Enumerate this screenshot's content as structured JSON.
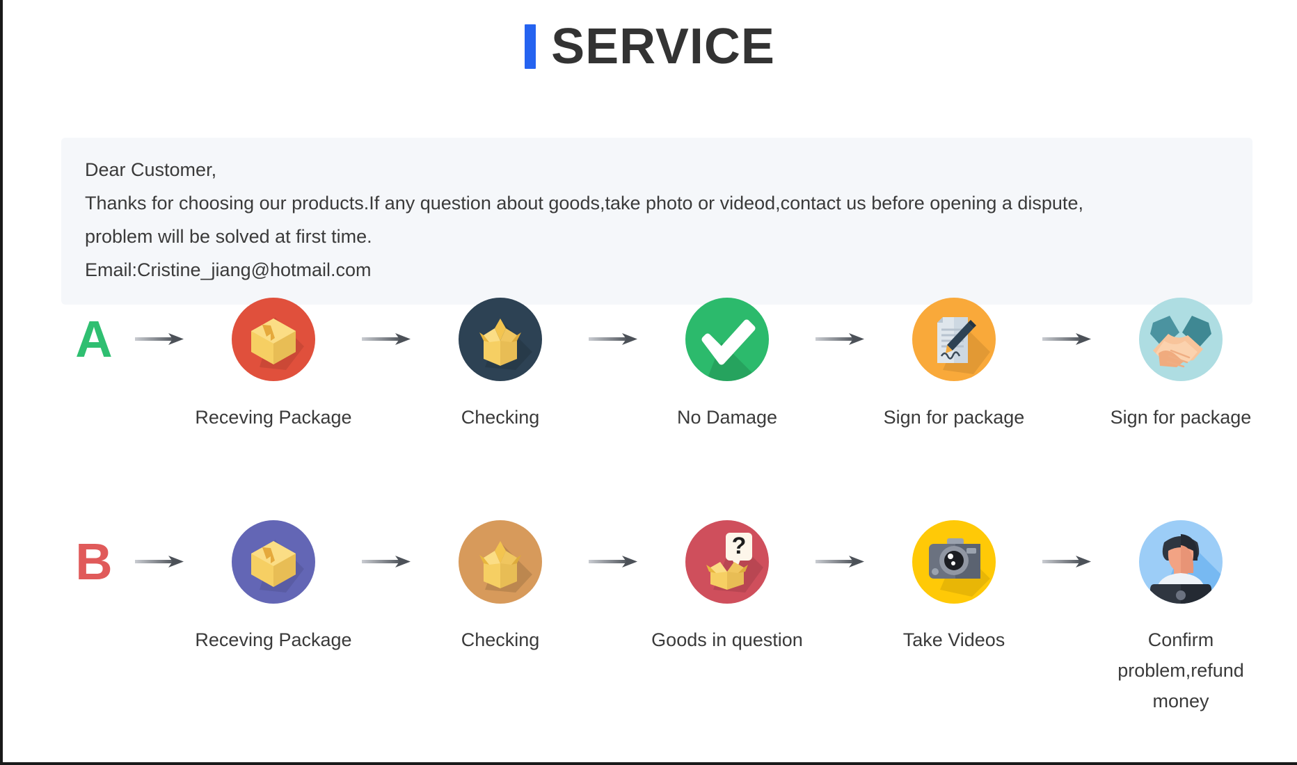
{
  "header": {
    "title": "SERVICE",
    "accent_color": "#2563f0"
  },
  "notice": {
    "line1": "Dear Customer,",
    "line2": "Thanks for choosing our products.If any question about goods,take photo or videod,contact us before opening a dispute,",
    "line3": "problem will be solved at first time.",
    "line4": "Email:Cristine_jiang@hotmail.com",
    "background_color": "#f5f7fa"
  },
  "flows": [
    {
      "letter": "A",
      "letter_color": "#2fbf71",
      "steps": [
        {
          "icon": "closed-box-icon",
          "circle_color": "#e0503c",
          "label": "Receving Package"
        },
        {
          "icon": "open-box-icon",
          "circle_color": "#2d4254",
          "label": "Checking"
        },
        {
          "icon": "check-mark-icon",
          "circle_color": "#2cba6c",
          "label": "No Damage"
        },
        {
          "icon": "signed-document-icon",
          "circle_color": "#f9a93a",
          "label": "Sign for package"
        },
        {
          "icon": "handshake-icon",
          "circle_color": "#aedde2",
          "label": "Sign for package"
        }
      ]
    },
    {
      "letter": "B",
      "letter_color": "#e05a5a",
      "steps": [
        {
          "icon": "closed-box-icon",
          "circle_color": "#6366b5",
          "label": "Receving Package"
        },
        {
          "icon": "open-box-icon",
          "circle_color": "#d79a5b",
          "label": "Checking"
        },
        {
          "icon": "question-box-icon",
          "circle_color": "#cf4f5c",
          "label": "Goods in question"
        },
        {
          "icon": "camera-icon",
          "circle_color": "#ffc907",
          "label": "Take Videos"
        },
        {
          "icon": "support-agent-icon",
          "circle_color": "#9ccdf7",
          "label": "Confirm problem,refund money"
        }
      ]
    }
  ],
  "arrow": {
    "name": "right-arrow-icon",
    "color": "#5a5f66"
  }
}
